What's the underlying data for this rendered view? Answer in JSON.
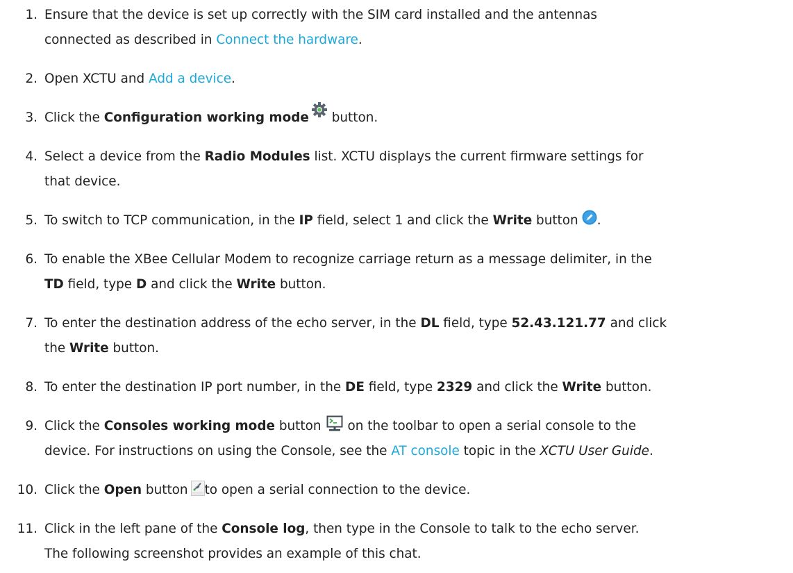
{
  "steps": [
    {
      "num": "1.",
      "a": "Ensure that the device is set up correctly with the SIM card installed and the antennas",
      "b": "connected as described in ",
      "link": "Connect the hardware",
      "c": "."
    },
    {
      "num": "2.",
      "a": "Open XCTU and ",
      "link": "Add a device",
      "b": "."
    },
    {
      "num": "3.",
      "a": "Click the ",
      "bold1": "Configuration working mode",
      "b": " button."
    },
    {
      "num": "4.",
      "a": "Select a device from the ",
      "bold1": "Radio Modules",
      "b": " list. XCTU displays the current firmware settings for",
      "c": "that device."
    },
    {
      "num": "5.",
      "a": "To switch to TCP communication, in the ",
      "bold1": "IP",
      "b": " field, select 1 and click the ",
      "bold2": "Write",
      "c": " button",
      "d": "."
    },
    {
      "num": "6.",
      "a": "To enable the XBee Cellular Modem to recognize carriage return as a message delimiter, in the",
      "bold1": "TD",
      "b": " field, type ",
      "bold2": "D",
      "c": " and click the ",
      "bold3": "Write",
      "d": " button."
    },
    {
      "num": "7.",
      "a": "To enter the destination address of the echo server, in the ",
      "bold1": "DL",
      "b": " field, type ",
      "bold2": "52.43.121.77",
      "c": " and click",
      "d": "the ",
      "bold3": "Write",
      "e": " button."
    },
    {
      "num": "8.",
      "a": "To enter the destination IP port number, in the ",
      "bold1": "DE",
      "b": " field, type ",
      "bold2": "2329",
      "c": " and click the ",
      "bold3": "Write",
      "d": " button."
    },
    {
      "num": "9.",
      "a": "Click the ",
      "bold1": "Consoles working mode",
      "b": " button",
      "c": "on the toolbar to open a serial console to the",
      "d": "device. For instructions on using the Console, see the ",
      "link": "AT console",
      "e": " topic in the ",
      "ital": "XCTU User Guide",
      "f": "."
    },
    {
      "num": "10.",
      "a": "Click the ",
      "bold1": "Open",
      "b": " button",
      "c": "to open a serial connection to the device."
    },
    {
      "num": "11.",
      "a": "Click in the left pane of the ",
      "bold1": "Console log",
      "b": ", then type in the Console to talk to the echo server.",
      "c": "The following screenshot provides an example of this chat."
    }
  ],
  "icons": {
    "gear": "gear-icon",
    "write": "write-icon",
    "console": "monitor-icon",
    "open": "open-connection-icon"
  },
  "colors": {
    "link": "#1ba8dc",
    "text": "#222222"
  }
}
